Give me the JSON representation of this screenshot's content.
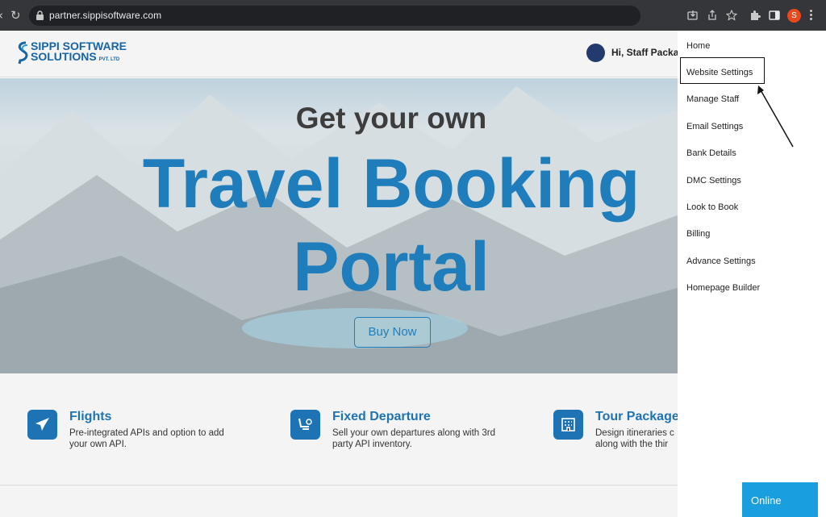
{
  "browser": {
    "url": "partner.sippisoftware.com",
    "profile_initial": "S"
  },
  "header": {
    "logo_line1": "SIPPI SOFTWARE",
    "logo_line2": "SOLUTIONS",
    "logo_suffix": "PVT. LTD",
    "greeting": "Hi, Staff Packag"
  },
  "hero": {
    "subtitle": "Get your own",
    "title_line1": "Travel Booking",
    "title_line2": "Portal",
    "cta_label": "Buy Now"
  },
  "features": [
    {
      "icon": "airplane-icon",
      "title": "Flights",
      "desc_line1": "Pre-integrated APIs and option to add",
      "desc_line2": "your own API."
    },
    {
      "icon": "fixed-departure-icon",
      "title": "Fixed Departure",
      "desc_line1": "Sell your own departures along with 3rd",
      "desc_line2": "party API inventory."
    },
    {
      "icon": "building-icon",
      "title": "Tour Package",
      "desc_line1": "Design itineraries c",
      "desc_line2": "along with the thir"
    }
  ],
  "menu": {
    "items": [
      "Home",
      "Website Settings",
      "Manage Staff",
      "Email Settings",
      "Bank Details",
      "DMC Settings",
      "Look to Book",
      "Billing",
      "Advance Settings",
      "Homepage Builder"
    ],
    "highlighted": "Website Settings"
  },
  "chat": {
    "status_label": "Online"
  },
  "colors": {
    "brand_blue": "#1e73b4",
    "chat_blue": "#199ee0",
    "browser_chrome": "#35363a"
  }
}
